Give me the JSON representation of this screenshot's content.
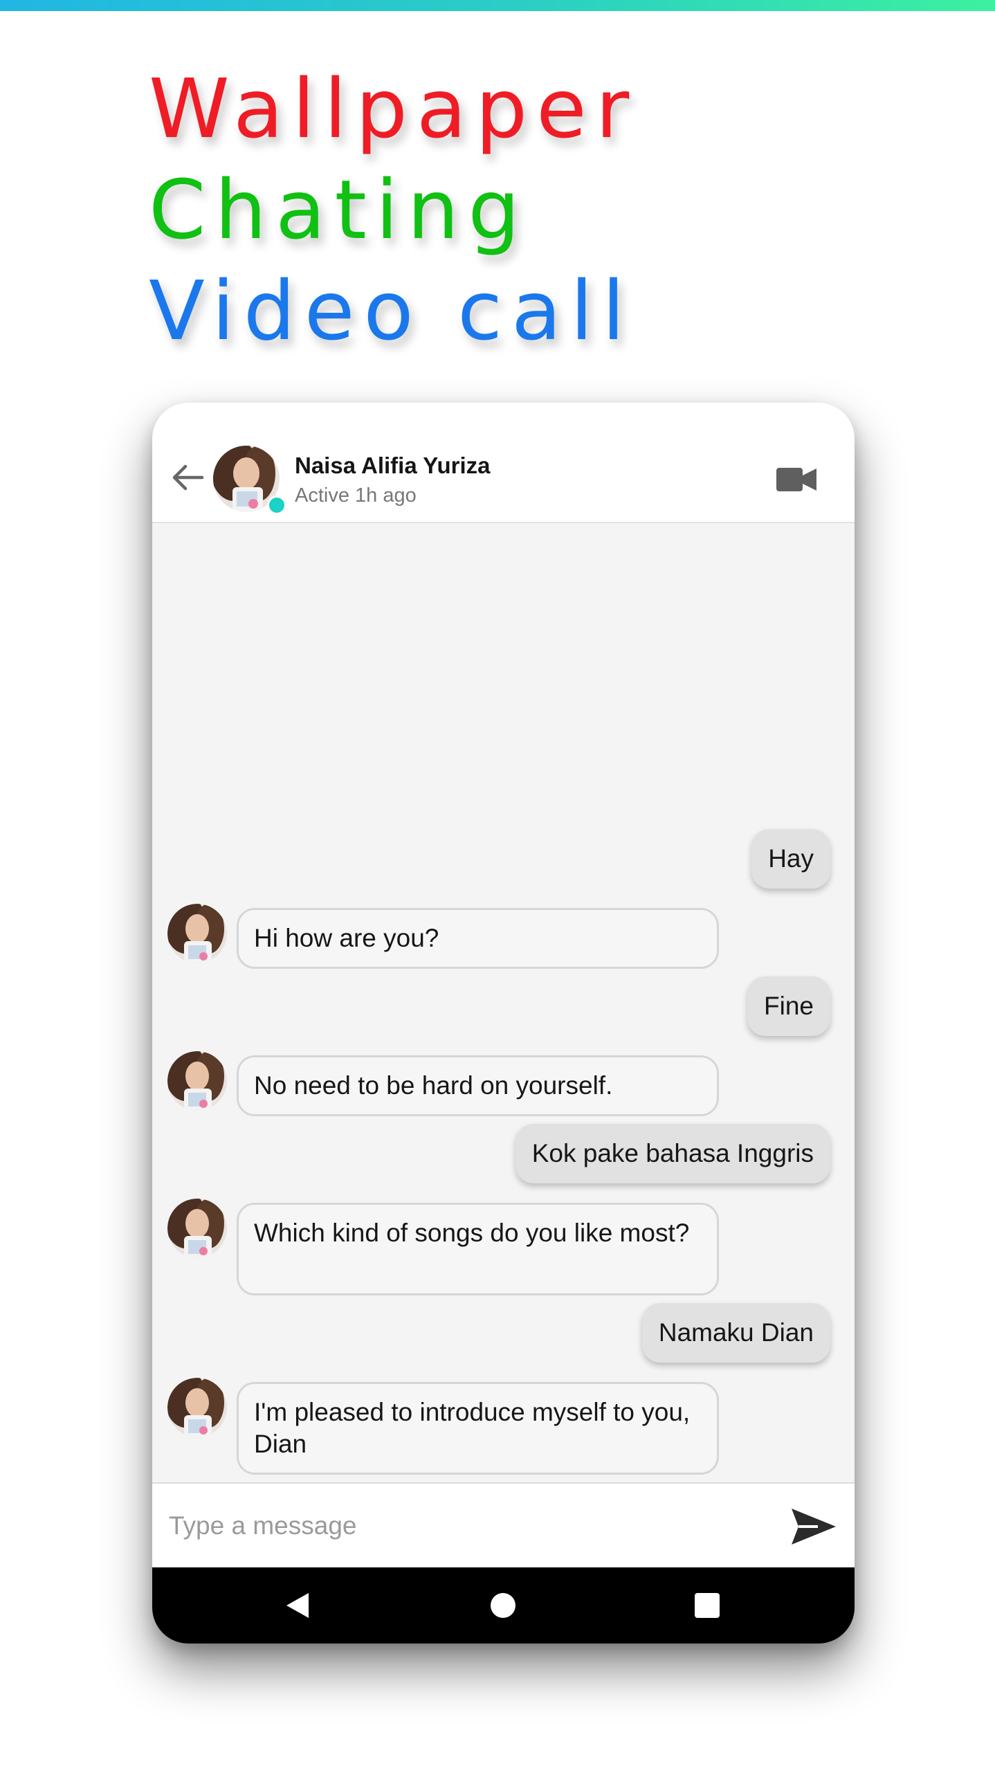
{
  "promo": {
    "line1": "Wallpaper",
    "line2": "Chating",
    "line3": "Video call"
  },
  "header": {
    "contact_name": "Naisa Alifia Yuriza",
    "status": "Active 1h ago",
    "icons": {
      "back": "back-arrow-icon",
      "video": "video-camera-icon"
    }
  },
  "messages": [
    {
      "from": "me",
      "text": "Hay"
    },
    {
      "from": "contact",
      "text": "Hi how are you?"
    },
    {
      "from": "me",
      "text": "Fine"
    },
    {
      "from": "contact",
      "text": "No need to be hard on yourself."
    },
    {
      "from": "me",
      "text": "Kok pake bahasa Inggris"
    },
    {
      "from": "contact",
      "text": "Which kind of songs do you like most?"
    },
    {
      "from": "me",
      "text": "Namaku Dian"
    },
    {
      "from": "contact",
      "text": "I'm pleased to introduce myself to you, Dian"
    }
  ],
  "composer": {
    "placeholder": "Type a message",
    "send_icon": "send-icon"
  },
  "colors": {
    "wallpaper_text": "#ef1c25",
    "chating_text": "#10c012",
    "video_call_text": "#1a78ec",
    "online_dot": "#1bd2c4"
  }
}
